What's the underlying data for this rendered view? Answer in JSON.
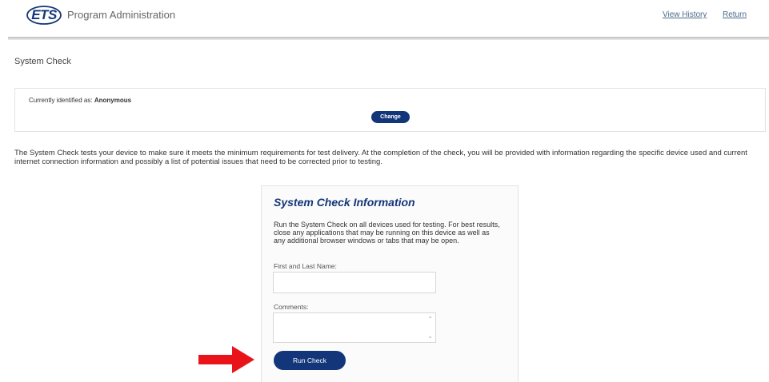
{
  "header": {
    "logo_text": "ETS",
    "app_title": "Program Administration",
    "view_history_label": "View History",
    "return_label": "Return"
  },
  "page": {
    "title": "System Check"
  },
  "identity": {
    "label": "Currently identified as:",
    "value": "Anonymous",
    "change_button_label": "Change"
  },
  "description": "The System Check tests your device to make sure it meets the minimum requirements for test delivery. At the completion of the check, you will be provided with information regarding the specific device used and current internet connection information and possibly a list of potential issues that need to be corrected prior to testing.",
  "system_check_info": {
    "title": "System Check Information",
    "body": "Run the System Check on all devices used for testing. For best results, close any applications that may be running on this device as well as any additional browser windows or tabs that may be open.",
    "name_label": "First and Last Name:",
    "name_value": "",
    "comments_label": "Comments:",
    "comments_value": "",
    "run_button_label": "Run Check"
  },
  "colors": {
    "brand_navy": "#13367a",
    "annotation_arrow": "#e8141a"
  },
  "icons": {
    "logo": "ets-logo",
    "arrow": "red-arrow-right",
    "scroll": "chevron-up-down"
  }
}
